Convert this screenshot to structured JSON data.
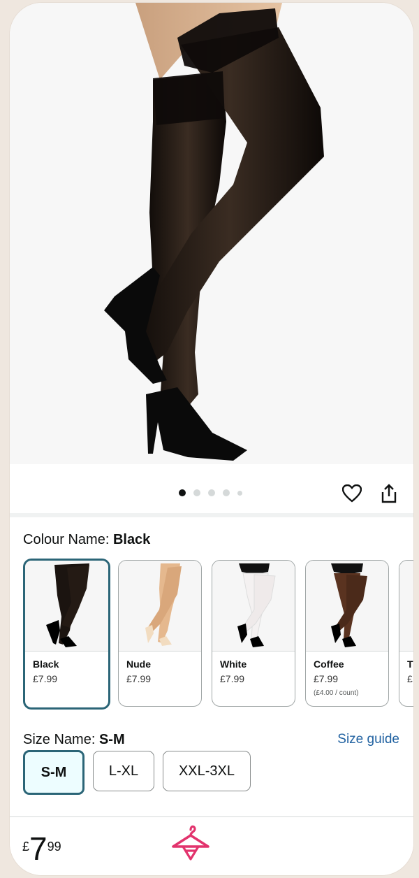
{
  "gallery": {
    "images_total": 5,
    "active_index": 0,
    "wishlist_icon": "heart-icon",
    "share_icon": "share-icon"
  },
  "colour": {
    "label": "Colour Name: ",
    "selected": "Black",
    "options": [
      {
        "name": "Black",
        "price": "£7.99",
        "unit": "",
        "tone": "#1b1410"
      },
      {
        "name": "Nude",
        "price": "£7.99",
        "unit": "",
        "tone": "#e5b88e"
      },
      {
        "name": "White",
        "price": "£7.99",
        "unit": "",
        "tone": "#f4f1f1"
      },
      {
        "name": "Coffee",
        "price": "£7.99",
        "unit": "(£4.00 / count)",
        "tone": "#5a3320"
      },
      {
        "name": "T",
        "price": "£",
        "unit": "",
        "tone": "#c49a72"
      }
    ]
  },
  "size": {
    "label": "Size Name: ",
    "selected": "S-M",
    "guide": "Size guide",
    "options": [
      "S-M",
      "L-XL",
      "XXL-3XL"
    ]
  },
  "bottom": {
    "currency": "£",
    "whole": "7",
    "fraction": "99",
    "logo": "hanger-logo-icon",
    "accent": "#e2336d"
  },
  "colors": {
    "selected_border": "#2b6577",
    "link": "#2162a1"
  }
}
